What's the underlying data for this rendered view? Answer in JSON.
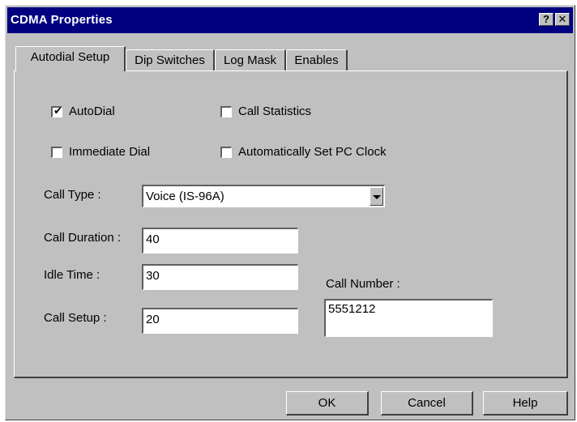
{
  "window": {
    "title": "CDMA Properties",
    "help_glyph": "?",
    "close_glyph": "✕"
  },
  "tabs": [
    {
      "label": "Autodial Setup",
      "active": true
    },
    {
      "label": "Dip Switches",
      "active": false
    },
    {
      "label": "Log Mask",
      "active": false
    },
    {
      "label": "Enables",
      "active": false
    }
  ],
  "checkboxes": {
    "autodial": {
      "label": "AutoDial",
      "checked": true
    },
    "immediate_dial": {
      "label": "Immediate Dial",
      "checked": false
    },
    "call_statistics": {
      "label": "Call Statistics",
      "checked": false
    },
    "auto_set_clock": {
      "label": "Automatically Set PC Clock",
      "checked": false
    }
  },
  "call_type": {
    "label": "Call Type :",
    "value": "Voice (IS-96A)"
  },
  "call_duration": {
    "label": "Call Duration :",
    "value": "40"
  },
  "idle_time": {
    "label": "Idle Time :",
    "value": "30"
  },
  "call_setup": {
    "label": "Call Setup :",
    "value": "20"
  },
  "call_number": {
    "label": "Call Number :",
    "value": "5551212"
  },
  "buttons": {
    "ok": "OK",
    "cancel": "Cancel",
    "help": "Help"
  },
  "colors": {
    "titlebar": "#000080",
    "face": "#c0c0c0"
  }
}
